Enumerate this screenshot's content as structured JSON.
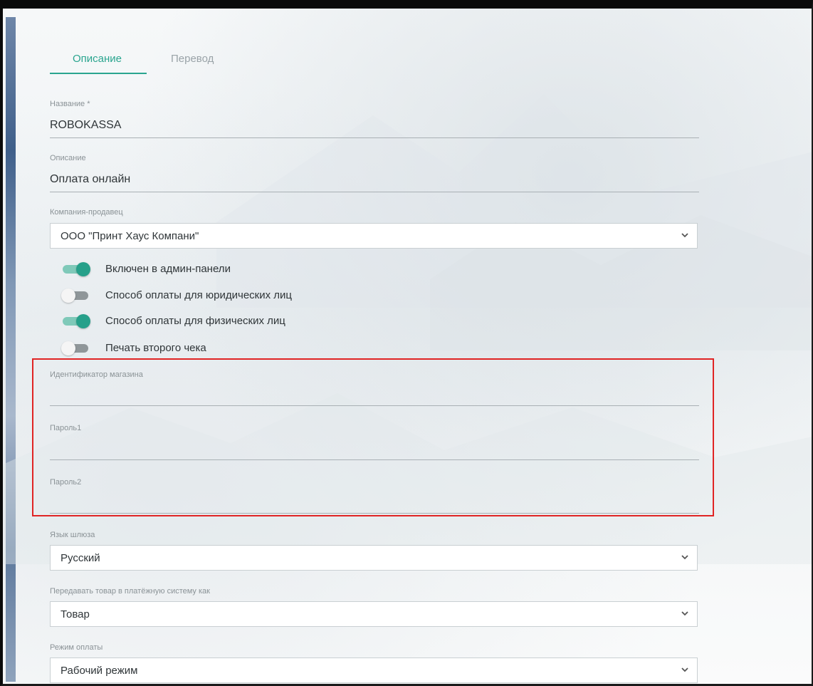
{
  "tabs": [
    {
      "label": "Описание",
      "active": true
    },
    {
      "label": "Перевод",
      "active": false
    }
  ],
  "fields": {
    "name": {
      "label": "Название *",
      "value": "ROBOKASSA"
    },
    "description": {
      "label": "Описание",
      "value": "Оплата онлайн"
    },
    "company": {
      "label": "Компания-продавец",
      "selected": "ООО \"Принт Хаус Компани\""
    },
    "shop_id": {
      "label": "Идентификатор магазина",
      "value": ""
    },
    "password1": {
      "label": "Пароль1",
      "value": ""
    },
    "password2": {
      "label": "Пароль2",
      "value": ""
    },
    "gateway_language": {
      "label": "Язык шлюза",
      "selected": "Русский"
    },
    "item_as": {
      "label": "Передавать товар в платёжную систему как",
      "selected": "Товар"
    },
    "payment_mode": {
      "label": "Режим оплаты",
      "selected": "Рабочий режим"
    }
  },
  "toggles": [
    {
      "label": "Включен в админ-панели",
      "on": true
    },
    {
      "label": "Способ оплаты для юридических лиц",
      "on": false
    },
    {
      "label": "Способ оплаты для физических лиц",
      "on": true
    },
    {
      "label": "Печать второго чека",
      "on": false
    }
  ],
  "colors": {
    "accent": "#2aa58f",
    "highlight_border": "#e02424"
  },
  "icons": {
    "select_chevron": "chevron-down-icon"
  }
}
